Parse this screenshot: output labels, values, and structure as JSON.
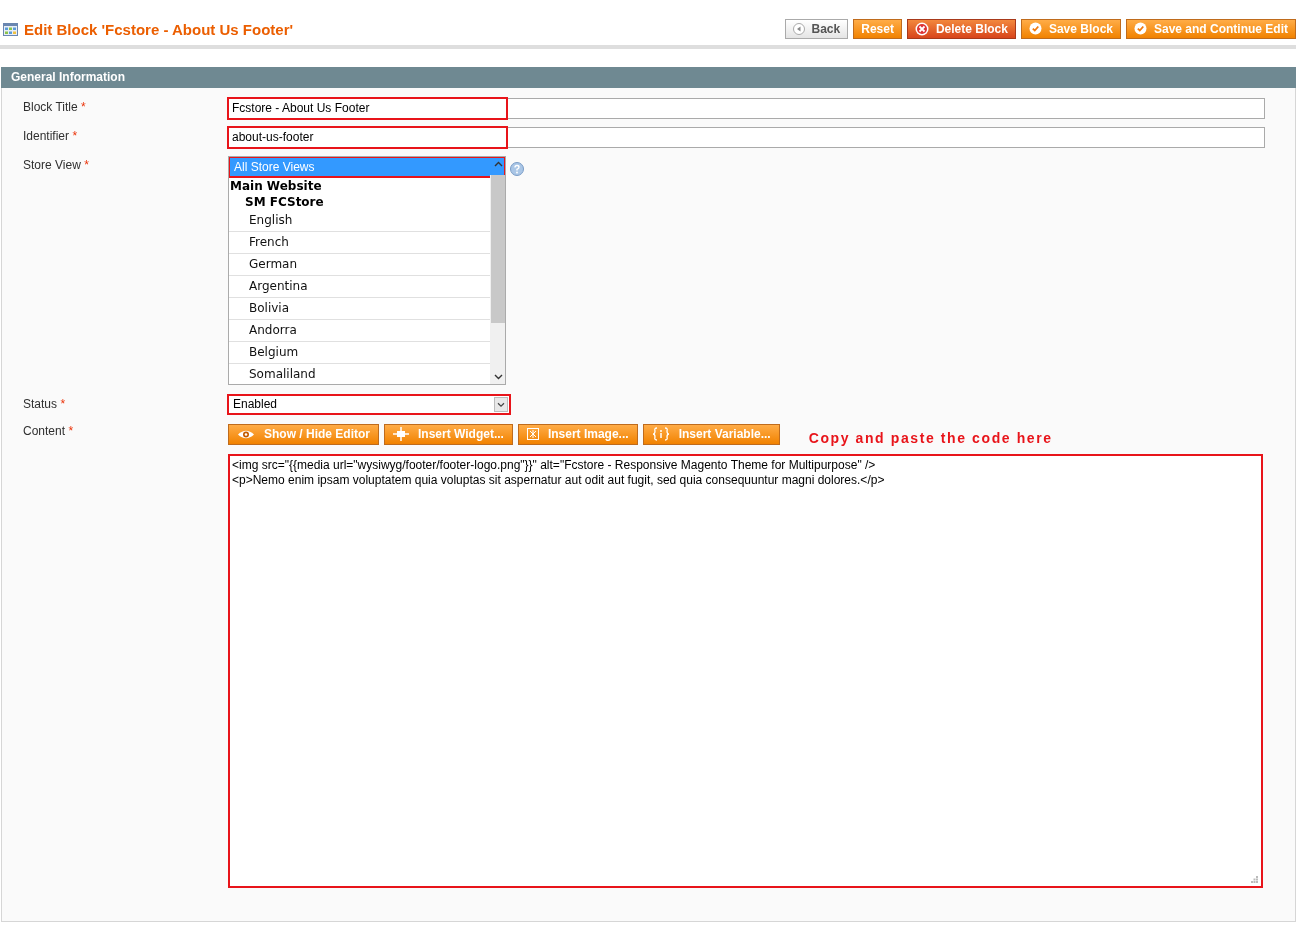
{
  "page_title": "Edit Block 'Fcstore - About Us Footer'",
  "header_buttons": [
    {
      "label": "Back",
      "kind": "back"
    },
    {
      "label": "Reset",
      "kind": "plain"
    },
    {
      "label": "Delete Block",
      "kind": "delete"
    },
    {
      "label": "Save Block",
      "kind": "save"
    },
    {
      "label": "Save and Continue Edit",
      "kind": "save"
    }
  ],
  "section_title": "General Information",
  "block_title": {
    "label": "Block Title",
    "required_mark": "*",
    "value": "Fcstore - About Us Footer"
  },
  "identifier": {
    "label": "Identifier",
    "required_mark": "*",
    "value": "about-us-footer"
  },
  "store_view": {
    "label": "Store View",
    "required_mark": "*",
    "options": [
      {
        "label": "All Store Views",
        "selected": true
      },
      {
        "label": "Main Website",
        "children": [
          {
            "label": "SM FCStore",
            "children": [
              {
                "label": "English",
                "selected": false
              },
              {
                "label": "French",
                "selected": false
              },
              {
                "label": "German",
                "selected": false
              },
              {
                "label": "Argentina",
                "selected": false
              },
              {
                "label": "Bolivia",
                "selected": false
              },
              {
                "label": "Andorra",
                "selected": false
              },
              {
                "label": "Belgium",
                "selected": false
              },
              {
                "label": "Somaliland",
                "selected": false
              }
            ]
          }
        ]
      }
    ]
  },
  "status": {
    "label": "Status",
    "required_mark": "*",
    "value": "Enabled"
  },
  "content": {
    "label": "Content",
    "required_mark": "*",
    "buttons": [
      {
        "label": "Show / Hide Editor",
        "kind": "eye"
      },
      {
        "label": "Insert Widget...",
        "kind": "widget"
      },
      {
        "label": "Insert Image...",
        "kind": "image"
      },
      {
        "label": "Insert Variable...",
        "kind": "variable"
      }
    ],
    "note": "Copy and paste the code here",
    "lines": [
      "<img src=\"{{media url=\"wysiwyg/footer/footer-logo.png\"}}\" alt=\"Fcstore - Responsive Magento Theme for Multipurpose\" />",
      "<p>Nemo enim ipsam voluptatem quia voluptas sit aspernatur aut odit aut fugit, sed quia consequuntur magni dolores.</p>"
    ]
  }
}
